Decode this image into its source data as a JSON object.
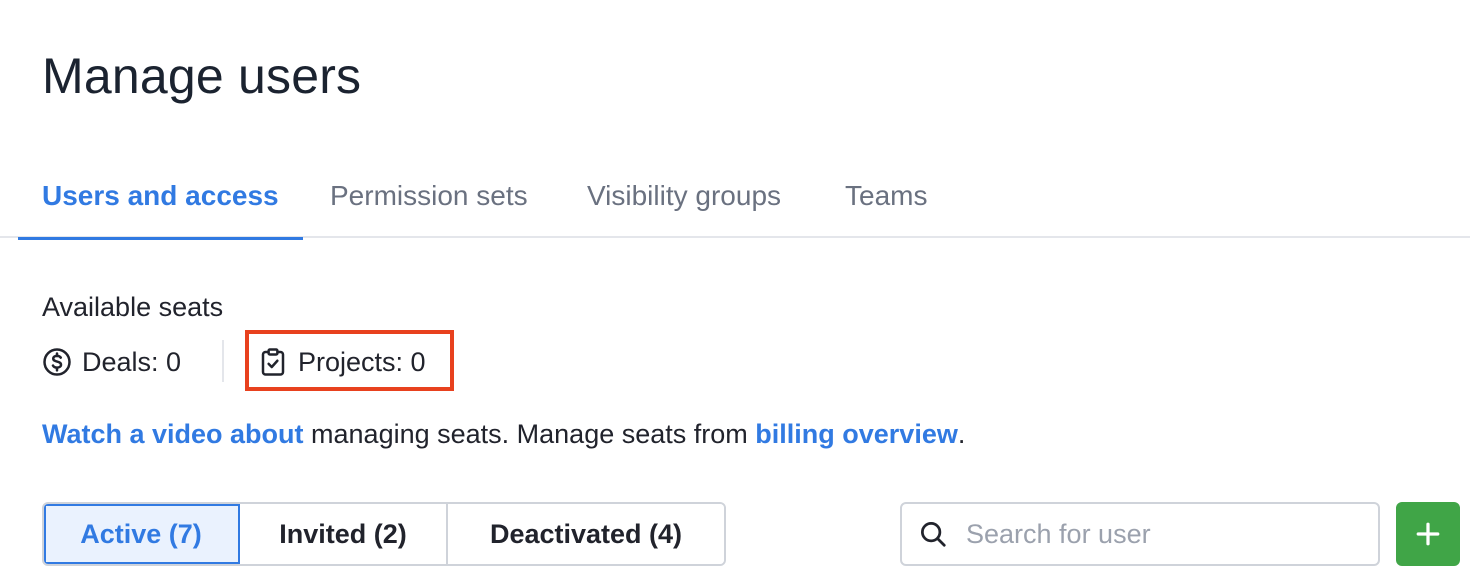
{
  "page": {
    "title": "Manage users"
  },
  "tabs": [
    {
      "label": "Users and access",
      "active": true
    },
    {
      "label": "Permission sets",
      "active": false
    },
    {
      "label": "Visibility groups",
      "active": false
    },
    {
      "label": "Teams",
      "active": false
    }
  ],
  "seats": {
    "label": "Available seats",
    "deals": {
      "text": "Deals: 0",
      "icon": "dollar-circle-icon"
    },
    "projects": {
      "text": "Projects: 0",
      "icon": "clipboard-check-icon"
    }
  },
  "info": {
    "link_video": "Watch a video about",
    "text_middle": " managing seats. Manage seats from ",
    "link_billing": "billing overview",
    "text_end": "."
  },
  "filters": [
    {
      "label": "Active (7)",
      "active": true
    },
    {
      "label": "Invited (2)",
      "active": false
    },
    {
      "label": "Deactivated (4)",
      "active": false
    }
  ],
  "search": {
    "placeholder": "Search for user",
    "icon": "search-icon"
  },
  "add_button": {
    "icon": "plus-icon"
  },
  "colors": {
    "accent": "#317ae2",
    "highlight": "#e8411e",
    "add_button": "#40a547"
  }
}
